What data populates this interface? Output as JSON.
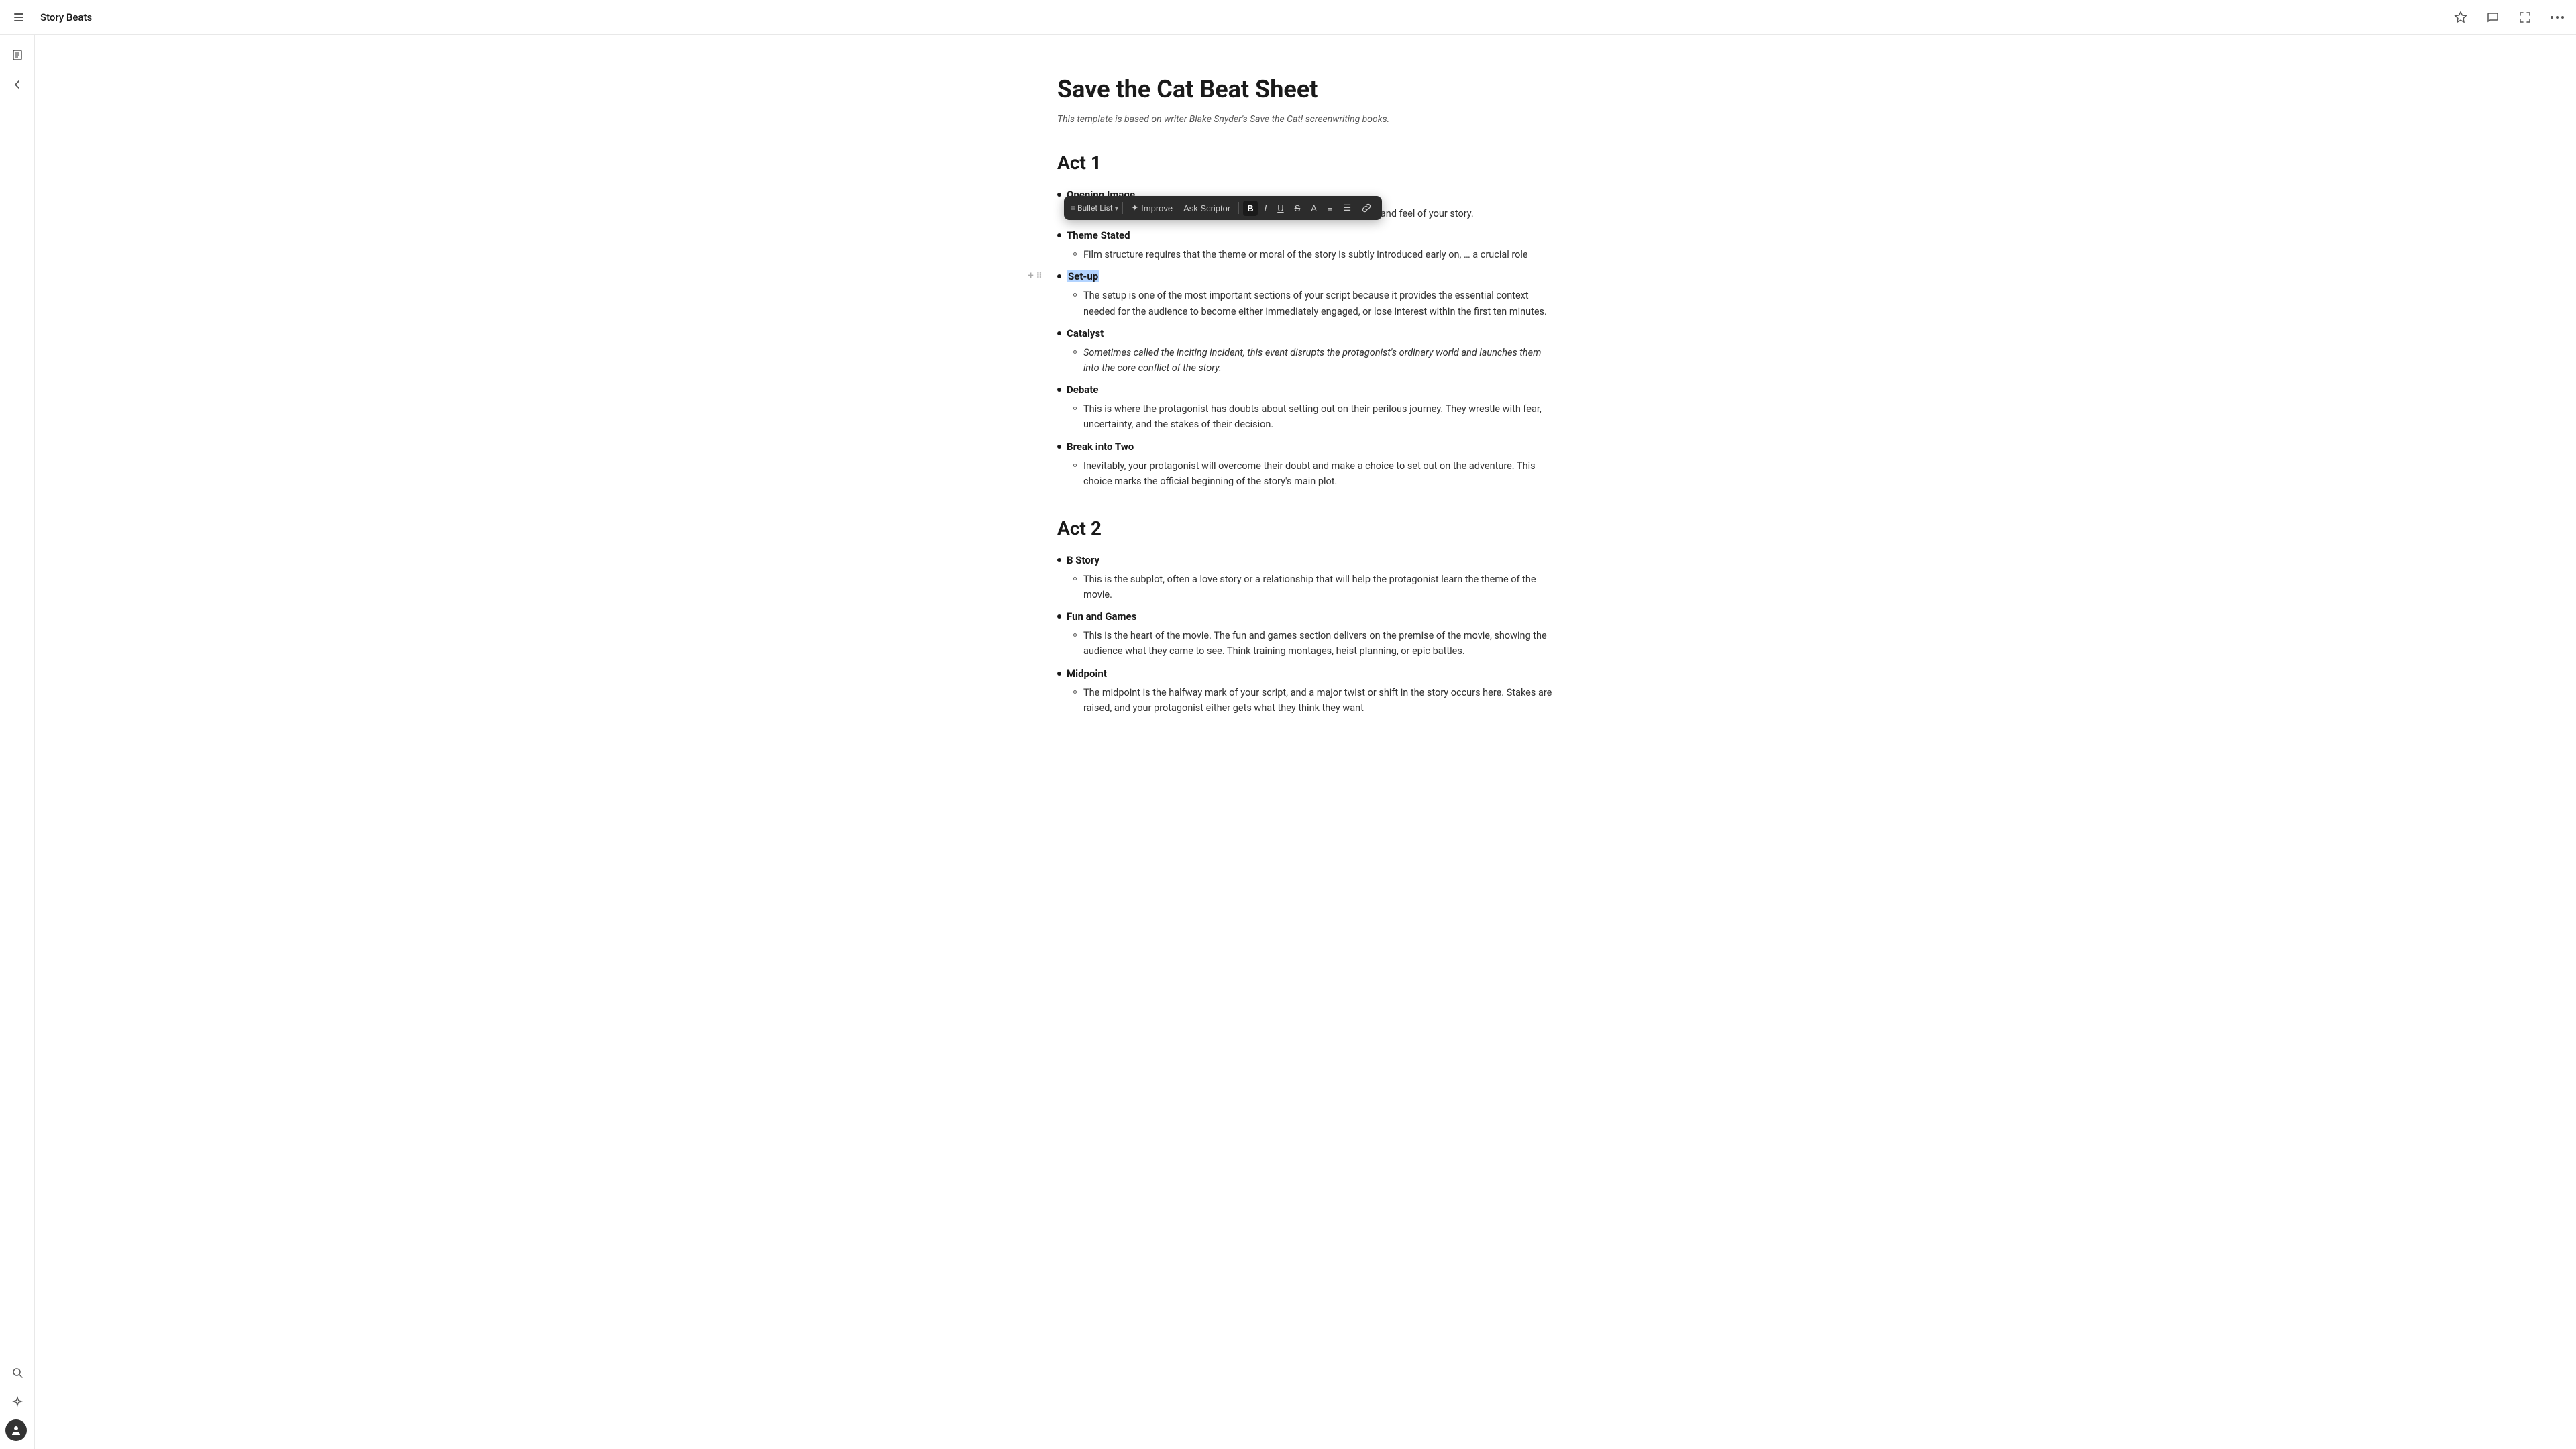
{
  "topbar": {
    "title": "Story Beats",
    "icons": {
      "star": "☆",
      "chat": "💬",
      "expand": "⤢",
      "more": "⋯"
    }
  },
  "sidebar": {
    "icons": {
      "pages": "📄",
      "back": "←",
      "search": "🔍",
      "sparkles": "✦",
      "avatar": "👤"
    }
  },
  "document": {
    "title": "Save the Cat Beat Sheet",
    "subtitle_pre": "This template is based on writer Blake Snyder's ",
    "subtitle_link": "Save the Cat!",
    "subtitle_post": " screenwriting books.",
    "act1": {
      "heading": "Act 1",
      "beats": [
        {
          "name": "Opening Image",
          "desc": "Start strong with an image that catapults your audience into the look and feel of your story."
        },
        {
          "name": "Theme Stated",
          "desc": "Film structure requires that the theme or moral of the story is subtly introduced early on, … a crucial role",
          "selected": false
        },
        {
          "name": "Set-up",
          "desc": "The setup is one of the most important sections of your script because it provides the essential context needed for the audience to become either immediately engaged, or lose interest within the first ten minutes.",
          "selected": true
        },
        {
          "name": "Catalyst",
          "desc": "Sometimes called the inciting incident, this event disrupts the protagonist's ordinary world and launches them into the core conflict of the story.",
          "italic": true
        },
        {
          "name": "Debate",
          "desc": "This is where the protagonist has doubts about setting out on their perilous journey. They wrestle with fear, uncertainty, and the stakes of their decision."
        },
        {
          "name": "Break into Two",
          "desc": "Inevitably, your protagonist will overcome their doubt and make a choice to set out on the adventure. This choice marks the official beginning of the story's main plot."
        }
      ]
    },
    "act2": {
      "heading": "Act 2",
      "beats": [
        {
          "name": "B Story",
          "desc": "This is the subplot, often a love story or a relationship that will help the protagonist learn the theme of the movie."
        },
        {
          "name": "Fun and Games",
          "desc": "This is the heart of the movie. The fun and games section delivers on the premise of the movie, showing the audience what they came to see. Think training montages, heist planning, or epic battles."
        },
        {
          "name": "Midpoint",
          "desc": "The midpoint is the halfway mark of your script, and a major twist or shift in the story occurs here. Stakes are raised, and your protagonist either gets what they think they want"
        }
      ]
    }
  },
  "toolbar": {
    "bullet_list_label": "Bullet List",
    "improve_label": "Improve",
    "ask_label": "Ask Scriptor",
    "bold_label": "B",
    "italic_label": "I",
    "underline_label": "U",
    "strikethrough_label": "S",
    "text_label": "A",
    "align_label": "≡",
    "list_label": "☰",
    "link_label": "🔗"
  }
}
